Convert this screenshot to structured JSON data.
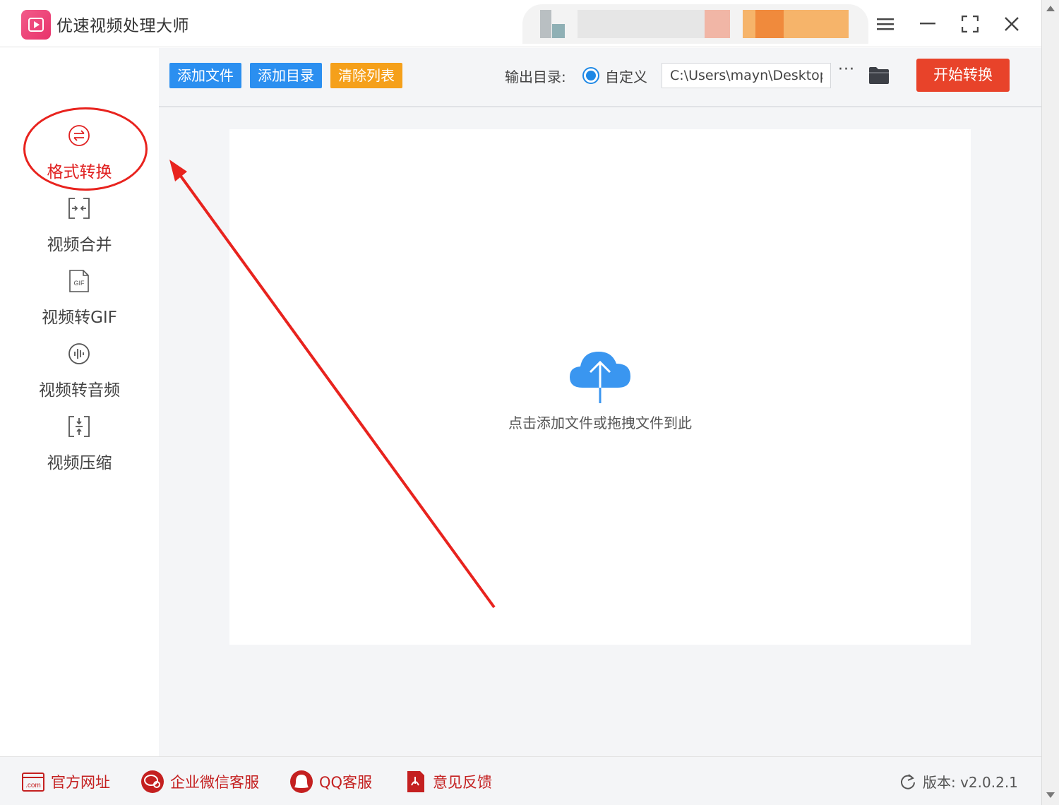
{
  "app": {
    "title": "优速视频处理大师"
  },
  "window_controls": {
    "menu_icon": "hamburger-menu-icon",
    "min_icon": "minimize-icon",
    "max_icon": "maximize-icon",
    "close_icon": "close-icon"
  },
  "sidebar": {
    "items": [
      {
        "label": "格式转换",
        "icon": "format-convert-icon",
        "active": true
      },
      {
        "label": "视频合并",
        "icon": "merge-icon",
        "active": false
      },
      {
        "label": "视频转GIF",
        "icon": "gif-icon",
        "active": false
      },
      {
        "label": "视频转音频",
        "icon": "audio-icon",
        "active": false
      },
      {
        "label": "视频压缩",
        "icon": "compress-icon",
        "active": false
      }
    ]
  },
  "toolbar": {
    "add_file": "添加文件",
    "add_dir": "添加目录",
    "clear_list": "清除列表",
    "output_label": "输出目录:",
    "custom_label": "自定义",
    "output_path": "C:\\Users\\mayn\\Desktop",
    "more": "···",
    "start": "开始转换"
  },
  "dropzone": {
    "text": "点击添加文件或拖拽文件到此"
  },
  "footer": {
    "website": "官方网址",
    "wechat": "企业微信客服",
    "qq": "QQ客服",
    "feedback": "意见反馈",
    "version": "版本: v2.0.2.1"
  },
  "colors": {
    "accent_blue": "#2b8ff0",
    "orange": "#f5a01a",
    "start_red": "#e8432a",
    "active_red": "#e02020"
  }
}
